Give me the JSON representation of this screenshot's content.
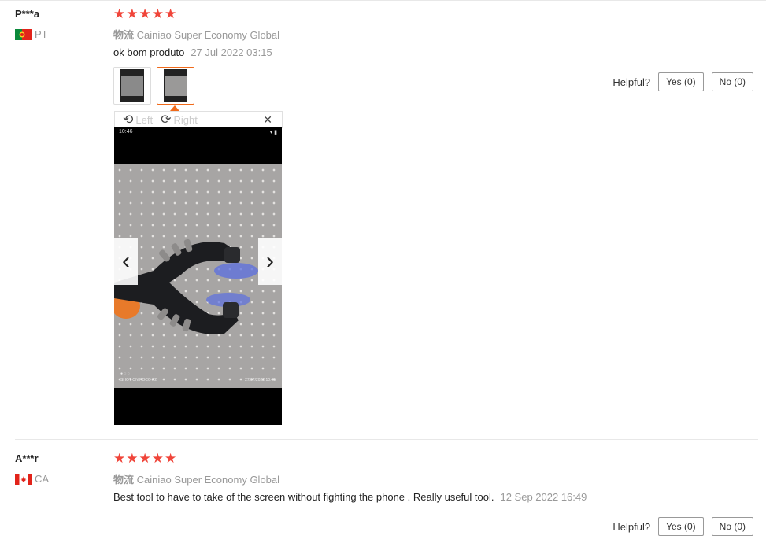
{
  "reviews": [
    {
      "user": "P***a",
      "country": "PT",
      "stars": "★★★★★",
      "logistics_label": "物流",
      "logistics_value": "Cainiao Super Economy Global",
      "comment": "ok bom produto",
      "date": "27 Jul 2022 03:15",
      "helpful_label": "Helpful?",
      "yes_label": "Yes (0)",
      "no_label": "No (0)"
    },
    {
      "user": "A***r",
      "country": "CA",
      "stars": "★★★★★",
      "logistics_label": "物流",
      "logistics_value": "Cainiao Super Economy Global",
      "comment": "Best tool to have to take of the screen without fighting the phone . Really useful tool.",
      "date": "12 Sep 2022 16:49",
      "helpful_label": "Helpful?",
      "yes_label": "Yes (0)",
      "no_label": "No (0)"
    }
  ],
  "viewer": {
    "rotate_left_label": "Left",
    "rotate_right_label": "Right",
    "close_symbol": "✕",
    "prev_symbol": "‹",
    "next_symbol": "›",
    "status_time": "10:46",
    "photo_watermark": "SHOT ON POCO F2",
    "photo_timestamp": "27/07/2022 10:45"
  },
  "colors": {
    "star": "#f0453a",
    "active_thumb_border": "#f06a1a",
    "muted_text": "#999999"
  },
  "icons": {
    "rotate_left": "rotate-left-icon",
    "rotate_right": "rotate-right-icon",
    "close": "close-icon",
    "prev": "chevron-left-icon",
    "next": "chevron-right-icon"
  }
}
